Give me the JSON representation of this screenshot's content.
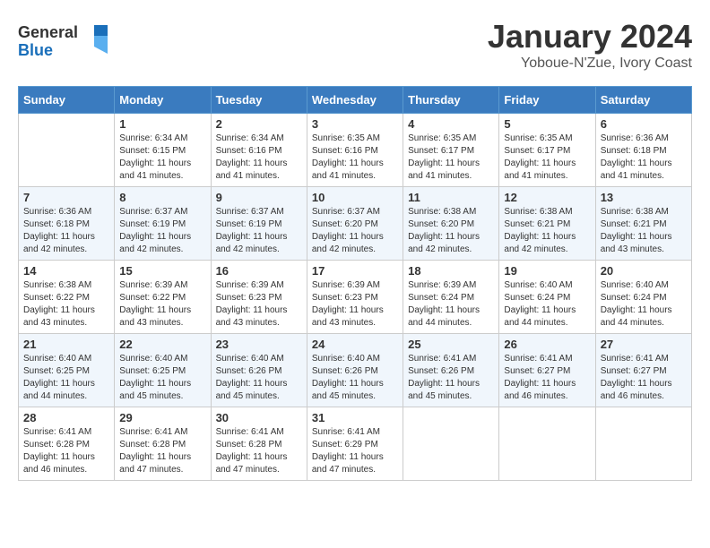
{
  "header": {
    "logo_general": "General",
    "logo_blue": "Blue",
    "month": "January 2024",
    "location": "Yoboue-N'Zue, Ivory Coast"
  },
  "weekdays": [
    "Sunday",
    "Monday",
    "Tuesday",
    "Wednesday",
    "Thursday",
    "Friday",
    "Saturday"
  ],
  "weeks": [
    [
      {
        "day": "",
        "sunrise": "",
        "sunset": "",
        "daylight": ""
      },
      {
        "day": "1",
        "sunrise": "Sunrise: 6:34 AM",
        "sunset": "Sunset: 6:15 PM",
        "daylight": "Daylight: 11 hours and 41 minutes."
      },
      {
        "day": "2",
        "sunrise": "Sunrise: 6:34 AM",
        "sunset": "Sunset: 6:16 PM",
        "daylight": "Daylight: 11 hours and 41 minutes."
      },
      {
        "day": "3",
        "sunrise": "Sunrise: 6:35 AM",
        "sunset": "Sunset: 6:16 PM",
        "daylight": "Daylight: 11 hours and 41 minutes."
      },
      {
        "day": "4",
        "sunrise": "Sunrise: 6:35 AM",
        "sunset": "Sunset: 6:17 PM",
        "daylight": "Daylight: 11 hours and 41 minutes."
      },
      {
        "day": "5",
        "sunrise": "Sunrise: 6:35 AM",
        "sunset": "Sunset: 6:17 PM",
        "daylight": "Daylight: 11 hours and 41 minutes."
      },
      {
        "day": "6",
        "sunrise": "Sunrise: 6:36 AM",
        "sunset": "Sunset: 6:18 PM",
        "daylight": "Daylight: 11 hours and 41 minutes."
      }
    ],
    [
      {
        "day": "7",
        "sunrise": "Sunrise: 6:36 AM",
        "sunset": "Sunset: 6:18 PM",
        "daylight": "Daylight: 11 hours and 42 minutes."
      },
      {
        "day": "8",
        "sunrise": "Sunrise: 6:37 AM",
        "sunset": "Sunset: 6:19 PM",
        "daylight": "Daylight: 11 hours and 42 minutes."
      },
      {
        "day": "9",
        "sunrise": "Sunrise: 6:37 AM",
        "sunset": "Sunset: 6:19 PM",
        "daylight": "Daylight: 11 hours and 42 minutes."
      },
      {
        "day": "10",
        "sunrise": "Sunrise: 6:37 AM",
        "sunset": "Sunset: 6:20 PM",
        "daylight": "Daylight: 11 hours and 42 minutes."
      },
      {
        "day": "11",
        "sunrise": "Sunrise: 6:38 AM",
        "sunset": "Sunset: 6:20 PM",
        "daylight": "Daylight: 11 hours and 42 minutes."
      },
      {
        "day": "12",
        "sunrise": "Sunrise: 6:38 AM",
        "sunset": "Sunset: 6:21 PM",
        "daylight": "Daylight: 11 hours and 42 minutes."
      },
      {
        "day": "13",
        "sunrise": "Sunrise: 6:38 AM",
        "sunset": "Sunset: 6:21 PM",
        "daylight": "Daylight: 11 hours and 43 minutes."
      }
    ],
    [
      {
        "day": "14",
        "sunrise": "Sunrise: 6:38 AM",
        "sunset": "Sunset: 6:22 PM",
        "daylight": "Daylight: 11 hours and 43 minutes."
      },
      {
        "day": "15",
        "sunrise": "Sunrise: 6:39 AM",
        "sunset": "Sunset: 6:22 PM",
        "daylight": "Daylight: 11 hours and 43 minutes."
      },
      {
        "day": "16",
        "sunrise": "Sunrise: 6:39 AM",
        "sunset": "Sunset: 6:23 PM",
        "daylight": "Daylight: 11 hours and 43 minutes."
      },
      {
        "day": "17",
        "sunrise": "Sunrise: 6:39 AM",
        "sunset": "Sunset: 6:23 PM",
        "daylight": "Daylight: 11 hours and 43 minutes."
      },
      {
        "day": "18",
        "sunrise": "Sunrise: 6:39 AM",
        "sunset": "Sunset: 6:24 PM",
        "daylight": "Daylight: 11 hours and 44 minutes."
      },
      {
        "day": "19",
        "sunrise": "Sunrise: 6:40 AM",
        "sunset": "Sunset: 6:24 PM",
        "daylight": "Daylight: 11 hours and 44 minutes."
      },
      {
        "day": "20",
        "sunrise": "Sunrise: 6:40 AM",
        "sunset": "Sunset: 6:24 PM",
        "daylight": "Daylight: 11 hours and 44 minutes."
      }
    ],
    [
      {
        "day": "21",
        "sunrise": "Sunrise: 6:40 AM",
        "sunset": "Sunset: 6:25 PM",
        "daylight": "Daylight: 11 hours and 44 minutes."
      },
      {
        "day": "22",
        "sunrise": "Sunrise: 6:40 AM",
        "sunset": "Sunset: 6:25 PM",
        "daylight": "Daylight: 11 hours and 45 minutes."
      },
      {
        "day": "23",
        "sunrise": "Sunrise: 6:40 AM",
        "sunset": "Sunset: 6:26 PM",
        "daylight": "Daylight: 11 hours and 45 minutes."
      },
      {
        "day": "24",
        "sunrise": "Sunrise: 6:40 AM",
        "sunset": "Sunset: 6:26 PM",
        "daylight": "Daylight: 11 hours and 45 minutes."
      },
      {
        "day": "25",
        "sunrise": "Sunrise: 6:41 AM",
        "sunset": "Sunset: 6:26 PM",
        "daylight": "Daylight: 11 hours and 45 minutes."
      },
      {
        "day": "26",
        "sunrise": "Sunrise: 6:41 AM",
        "sunset": "Sunset: 6:27 PM",
        "daylight": "Daylight: 11 hours and 46 minutes."
      },
      {
        "day": "27",
        "sunrise": "Sunrise: 6:41 AM",
        "sunset": "Sunset: 6:27 PM",
        "daylight": "Daylight: 11 hours and 46 minutes."
      }
    ],
    [
      {
        "day": "28",
        "sunrise": "Sunrise: 6:41 AM",
        "sunset": "Sunset: 6:28 PM",
        "daylight": "Daylight: 11 hours and 46 minutes."
      },
      {
        "day": "29",
        "sunrise": "Sunrise: 6:41 AM",
        "sunset": "Sunset: 6:28 PM",
        "daylight": "Daylight: 11 hours and 47 minutes."
      },
      {
        "day": "30",
        "sunrise": "Sunrise: 6:41 AM",
        "sunset": "Sunset: 6:28 PM",
        "daylight": "Daylight: 11 hours and 47 minutes."
      },
      {
        "day": "31",
        "sunrise": "Sunrise: 6:41 AM",
        "sunset": "Sunset: 6:29 PM",
        "daylight": "Daylight: 11 hours and 47 minutes."
      },
      {
        "day": "",
        "sunrise": "",
        "sunset": "",
        "daylight": ""
      },
      {
        "day": "",
        "sunrise": "",
        "sunset": "",
        "daylight": ""
      },
      {
        "day": "",
        "sunrise": "",
        "sunset": "",
        "daylight": ""
      }
    ]
  ]
}
